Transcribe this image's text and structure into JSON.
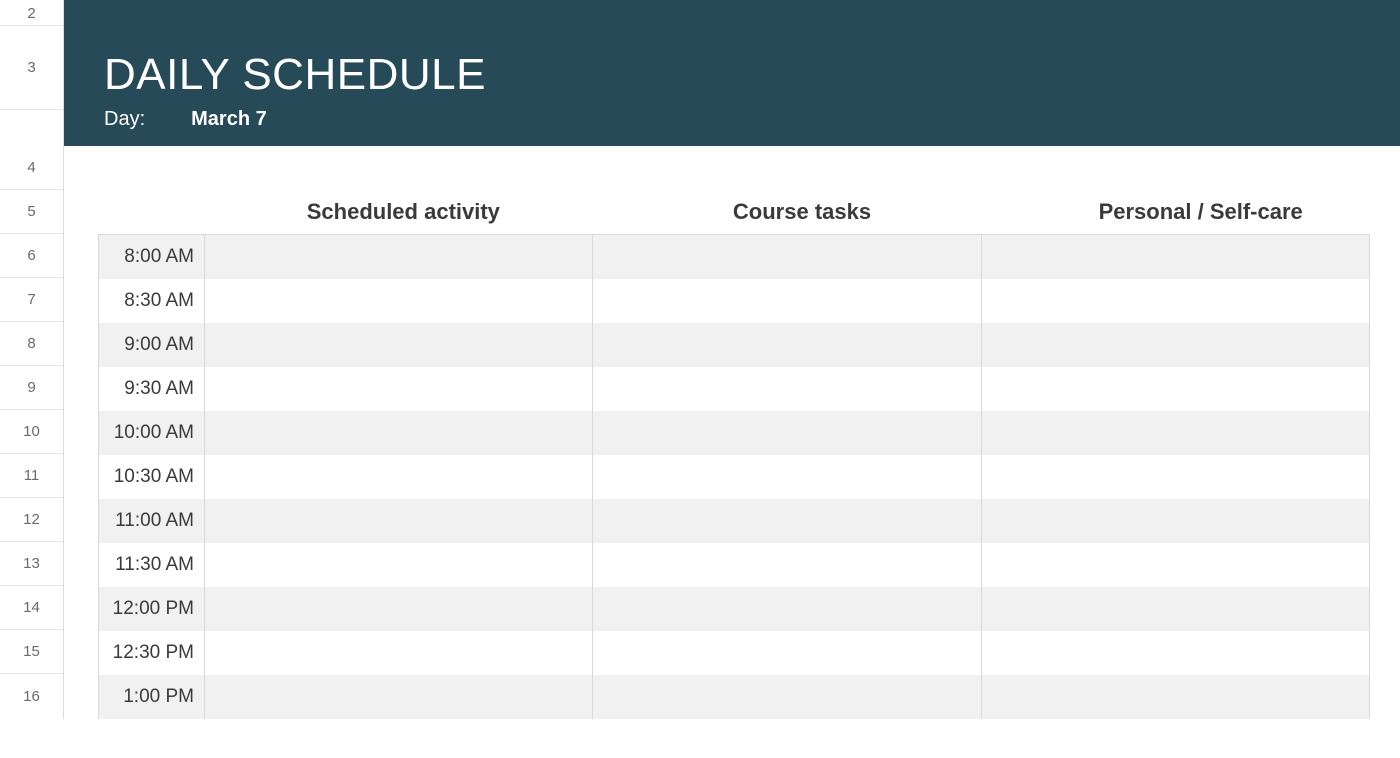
{
  "rowNumbers": [
    "2",
    "3",
    "4",
    "5",
    "6",
    "7",
    "8",
    "9",
    "10",
    "11",
    "12",
    "13",
    "14",
    "15",
    "16"
  ],
  "banner": {
    "title": "DAILY SCHEDULE",
    "dayLabel": "Day:",
    "dayValue": "March 7"
  },
  "columns": {
    "c1": "Scheduled activity",
    "c2": "Course tasks",
    "c3": "Personal / Self-care"
  },
  "times": [
    "8:00 AM",
    "8:30 AM",
    "9:00 AM",
    "9:30 AM",
    "10:00 AM",
    "10:30 AM",
    "11:00 AM",
    "11:30 AM",
    "12:00 PM",
    "12:30 PM",
    "1:00 PM"
  ],
  "cells": {
    "scheduled": [
      "",
      "",
      "",
      "",
      "",
      "",
      "",
      "",
      "",
      "",
      ""
    ],
    "course": [
      "",
      "",
      "",
      "",
      "",
      "",
      "",
      "",
      "",
      "",
      ""
    ],
    "personal": [
      "",
      "",
      "",
      "",
      "",
      "",
      "",
      "",
      "",
      "",
      ""
    ]
  }
}
